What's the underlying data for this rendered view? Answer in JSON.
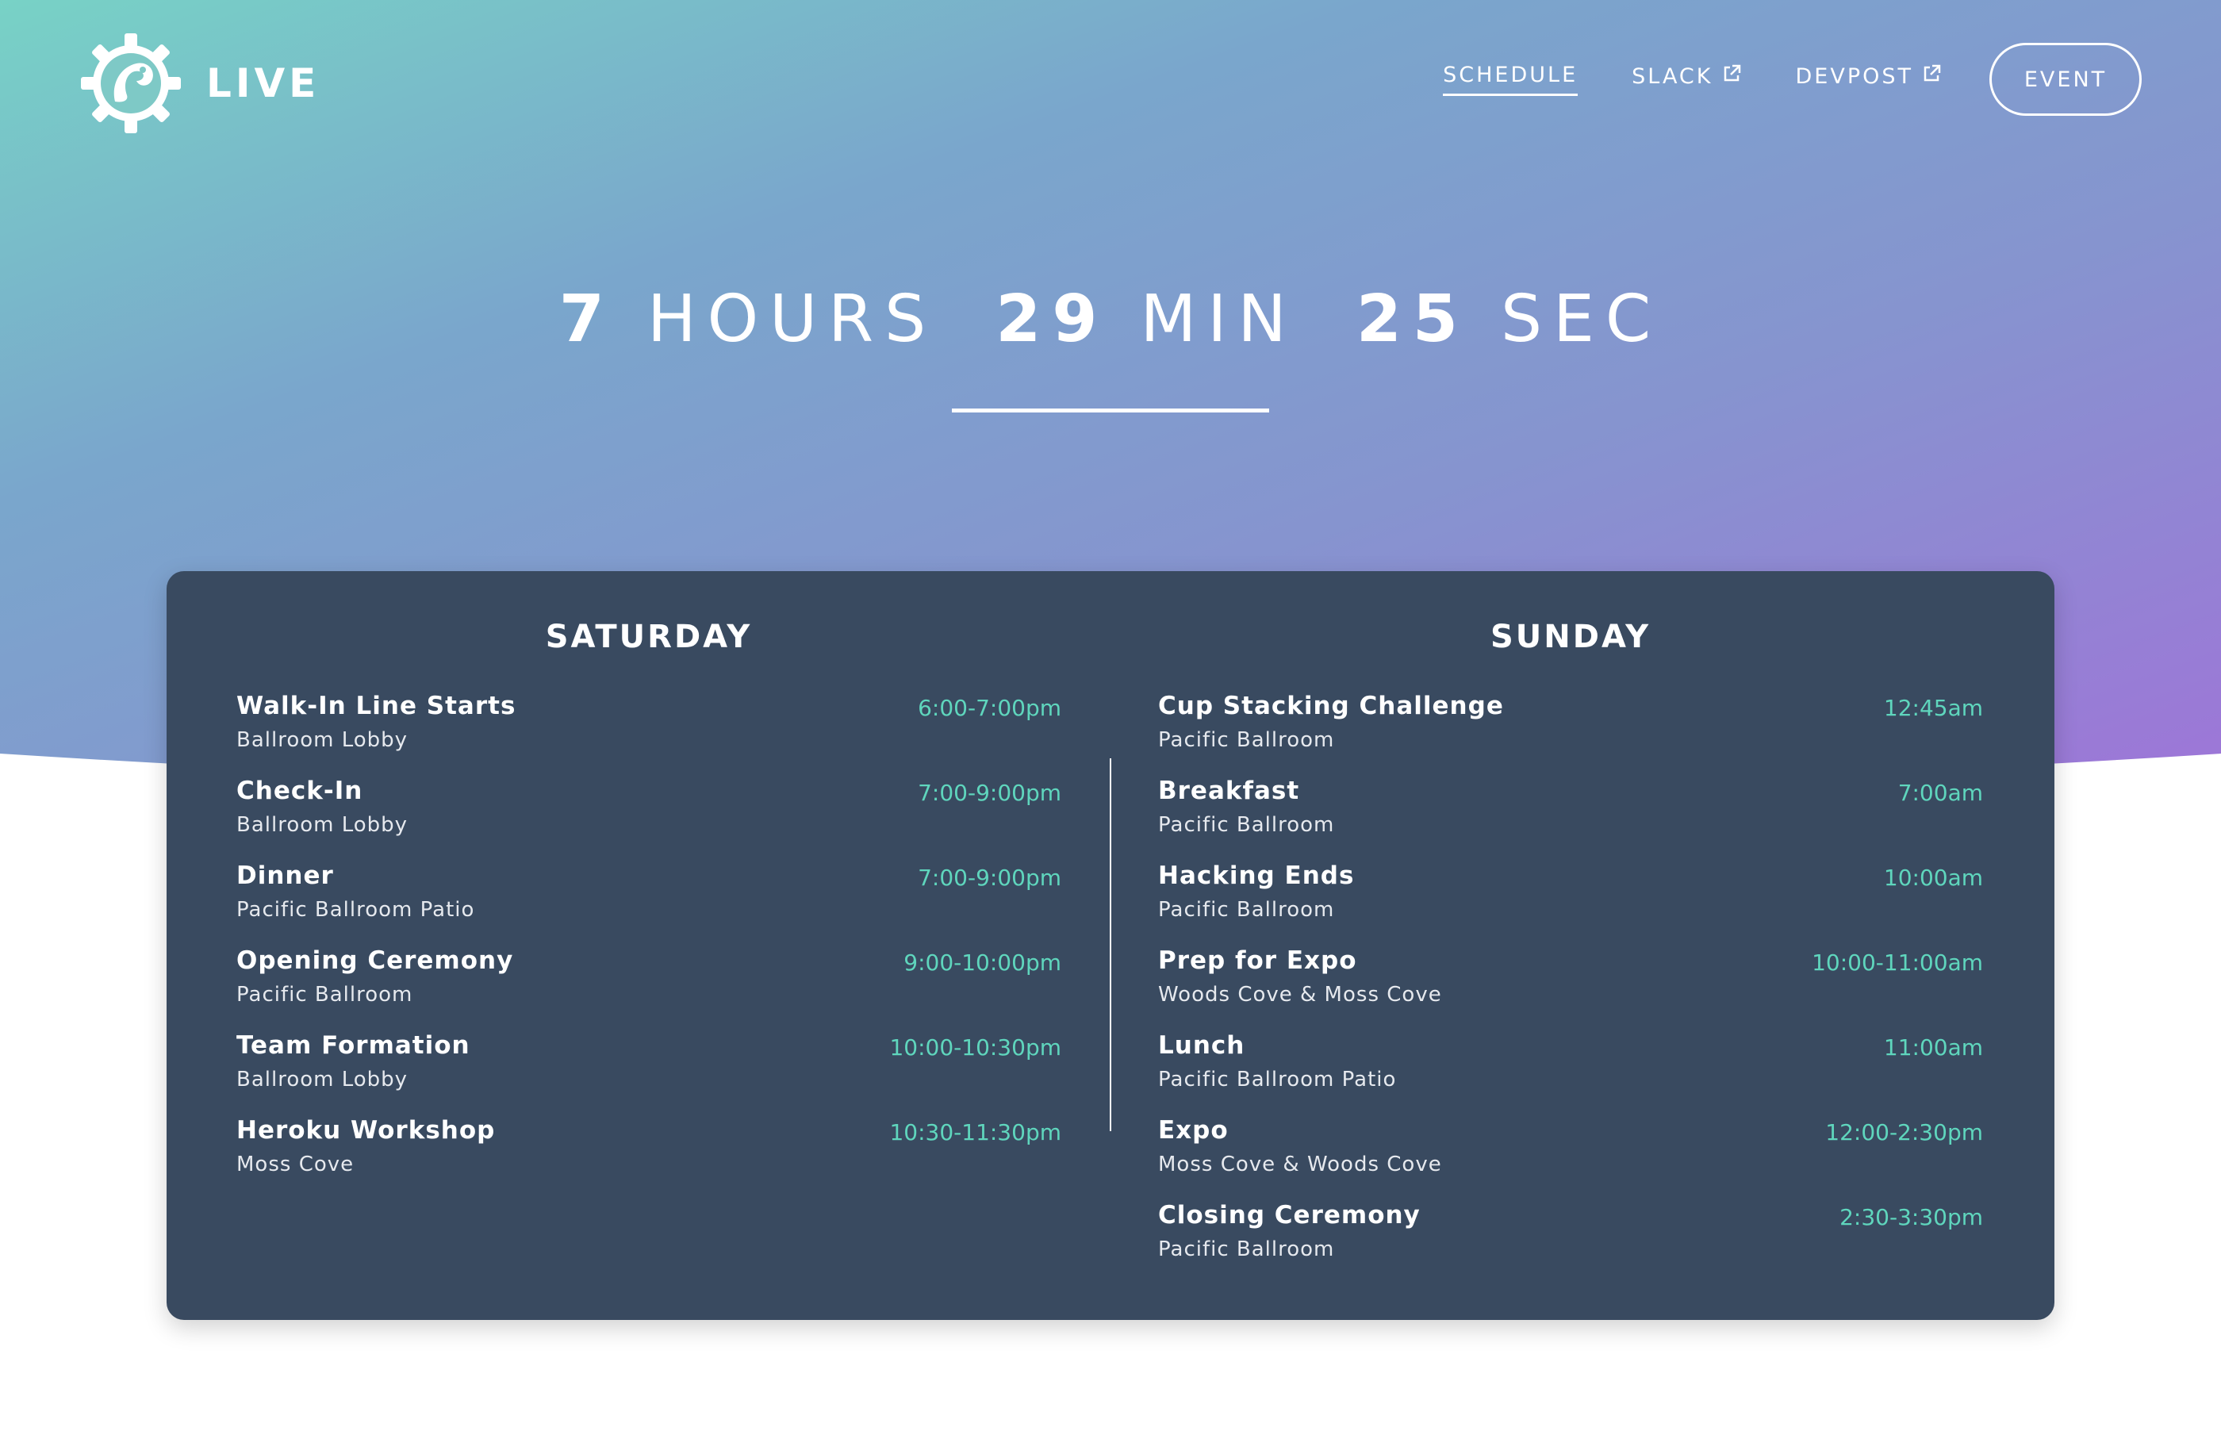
{
  "brand": {
    "name": "LIVE"
  },
  "nav": {
    "links": [
      {
        "label": "SCHEDULE",
        "active": true,
        "external": false
      },
      {
        "label": "SLACK",
        "active": false,
        "external": true
      },
      {
        "label": "DEVPOST",
        "active": false,
        "external": true
      }
    ],
    "event_button": "EVENT"
  },
  "countdown": {
    "hours": "7",
    "hours_unit": "HOURS",
    "minutes": "29",
    "minutes_unit": "MIN",
    "seconds": "25",
    "seconds_unit": "SEC"
  },
  "schedule": {
    "saturday": {
      "title": "SATURDAY",
      "events": [
        {
          "name": "Walk-In Line Starts",
          "location": "Ballroom Lobby",
          "time": "6:00-7:00pm"
        },
        {
          "name": "Check-In",
          "location": "Ballroom Lobby",
          "time": "7:00-9:00pm"
        },
        {
          "name": "Dinner",
          "location": "Pacific Ballroom Patio",
          "time": "7:00-9:00pm"
        },
        {
          "name": "Opening Ceremony",
          "location": "Pacific Ballroom",
          "time": "9:00-10:00pm"
        },
        {
          "name": "Team Formation",
          "location": "Ballroom Lobby",
          "time": "10:00-10:30pm"
        },
        {
          "name": "Heroku Workshop",
          "location": "Moss Cove",
          "time": "10:30-11:30pm"
        }
      ]
    },
    "sunday": {
      "title": "SUNDAY",
      "events": [
        {
          "name": "Cup Stacking Challenge",
          "location": "Pacific Ballroom",
          "time": "12:45am"
        },
        {
          "name": "Breakfast",
          "location": "Pacific Ballroom",
          "time": "7:00am"
        },
        {
          "name": "Hacking Ends",
          "location": "Pacific Ballroom",
          "time": "10:00am"
        },
        {
          "name": "Prep for Expo",
          "location": "Woods Cove & Moss Cove",
          "time": "10:00-11:00am"
        },
        {
          "name": "Lunch",
          "location": "Pacific Ballroom Patio",
          "time": "11:00am"
        },
        {
          "name": "Expo",
          "location": "Moss Cove & Woods Cove",
          "time": "12:00-2:30pm"
        },
        {
          "name": "Closing Ceremony",
          "location": "Pacific Ballroom",
          "time": "2:30-3:30pm"
        }
      ]
    }
  },
  "colors": {
    "card_bg": "#394a60",
    "time_accent": "#5fd6bd",
    "gradient_start": "#78d2c6",
    "gradient_end": "#a171d9"
  }
}
